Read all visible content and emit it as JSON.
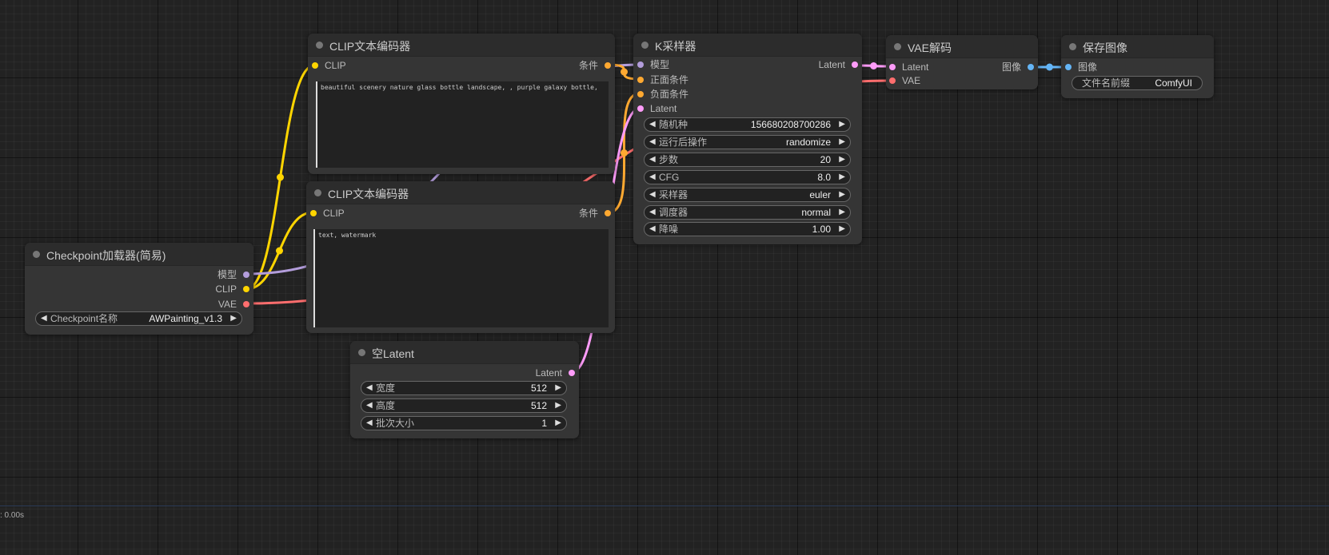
{
  "colors": {
    "clip": "#ffd500",
    "model": "#b39ddb",
    "vae": "#ff6e6e",
    "conditioning": "#ffa931",
    "latent": "#ff9cf9",
    "image": "#64b5f6"
  },
  "nodes": {
    "checkpoint": {
      "title": "Checkpoint加载器(简易)",
      "outputs": {
        "model": "模型",
        "clip": "CLIP",
        "vae": "VAE"
      },
      "widgets": {
        "ckpt_label": "Checkpoint名称",
        "ckpt_value": "AWPainting_v1.3"
      }
    },
    "clip_pos": {
      "title": "CLIP文本编码器",
      "input_clip": "CLIP",
      "output_cond": "条件",
      "text": "beautiful scenery nature glass bottle landscape, , purple galaxy bottle,"
    },
    "clip_neg": {
      "title": "CLIP文本编码器",
      "input_clip": "CLIP",
      "output_cond": "条件",
      "text": "text, watermark"
    },
    "empty_latent": {
      "title": "空Latent",
      "output_latent": "Latent",
      "widgets": [
        {
          "label": "宽度",
          "value": "512"
        },
        {
          "label": "高度",
          "value": "512"
        },
        {
          "label": "批次大小",
          "value": "1"
        }
      ]
    },
    "ksampler": {
      "title": "K采样器",
      "inputs": {
        "model": "模型",
        "positive": "正面条件",
        "negative": "负面条件",
        "latent": "Latent"
      },
      "output_latent": "Latent",
      "widgets": [
        {
          "label": "随机种",
          "value": "156680208700286"
        },
        {
          "label": "运行后操作",
          "value": "randomize"
        },
        {
          "label": "步数",
          "value": "20"
        },
        {
          "label": "CFG",
          "value": "8.0"
        },
        {
          "label": "采样器",
          "value": "euler"
        },
        {
          "label": "调度器",
          "value": "normal"
        },
        {
          "label": "降噪",
          "value": "1.00"
        }
      ]
    },
    "vae_decode": {
      "title": "VAE解码",
      "inputs": {
        "latent": "Latent",
        "vae": "VAE"
      },
      "output_image": "图像"
    },
    "save_image": {
      "title": "保存图像",
      "input_image": "图像",
      "widgets": {
        "prefix_label": "文件名前缀",
        "prefix_value": "ComfyUI"
      }
    }
  },
  "status": {
    "timer": ": 0.00s"
  }
}
